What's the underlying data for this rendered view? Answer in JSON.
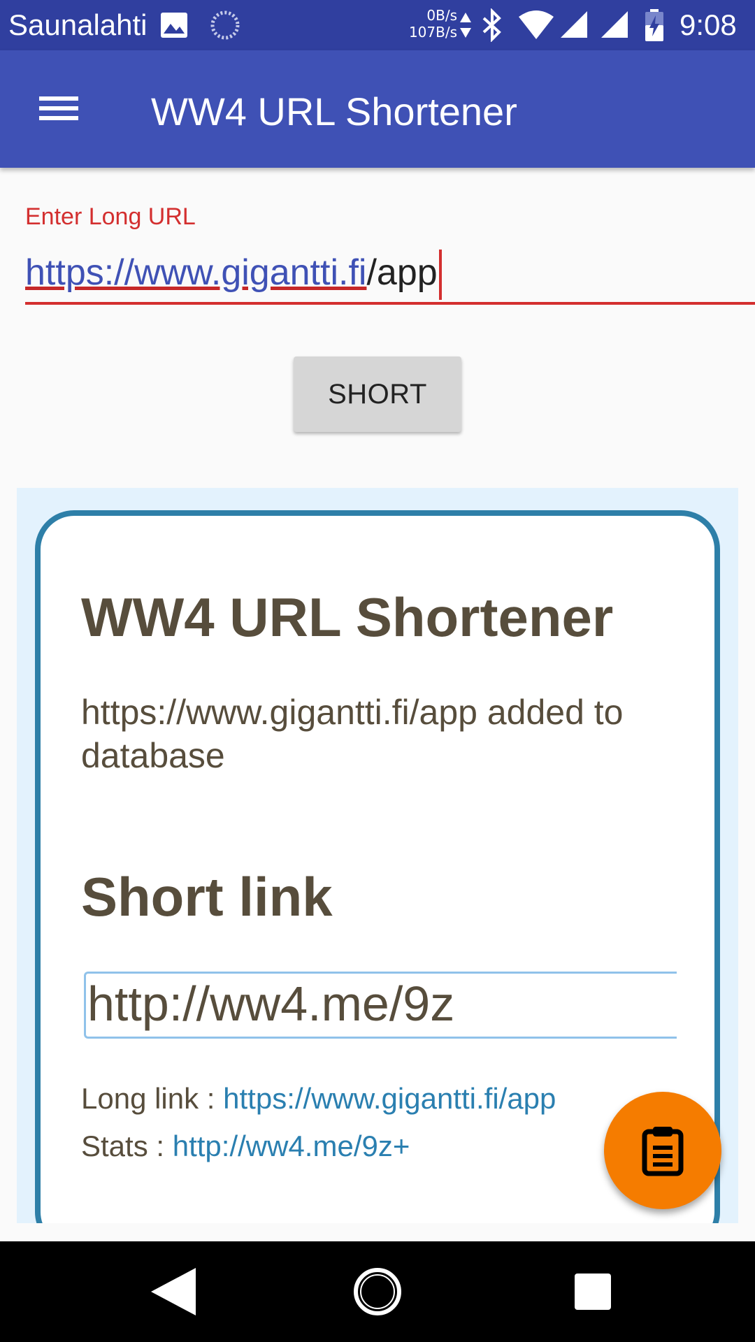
{
  "status_bar": {
    "carrier": "Saunalahti",
    "net_up": "0B/s",
    "net_down": "107B/s",
    "time": "9:08",
    "icons": [
      "gallery-icon",
      "sync-icon",
      "bluetooth-icon",
      "wifi-icon",
      "signal-icon",
      "battery-charging-icon"
    ]
  },
  "app_bar": {
    "title": "WW4 URL Shortener",
    "menu_icon": "hamburger-menu-icon"
  },
  "form": {
    "label": "Enter Long URL",
    "value_link": "https://www.gigantti.fi",
    "value_rest": "/app",
    "short_button": "SHORT"
  },
  "result": {
    "title": "WW4 URL Shortener",
    "message": "https://www.gigantti.fi/app added to database",
    "short_heading": "Short link",
    "short_link": "http://ww4.me/9z",
    "long_label": "Long link : ",
    "long_link": "https://www.gigantti.fi/app",
    "stats_label": "Stats : ",
    "stats_link": "http://ww4.me/9z+"
  },
  "fab": {
    "icon": "clipboard-icon"
  },
  "colors": {
    "status_bar": "#303f9f",
    "app_bar": "#3f51b5",
    "accent_error": "#d32f2f",
    "fab": "#f57c00",
    "card_border": "#2e7fa8",
    "link": "#2a7fb0"
  }
}
